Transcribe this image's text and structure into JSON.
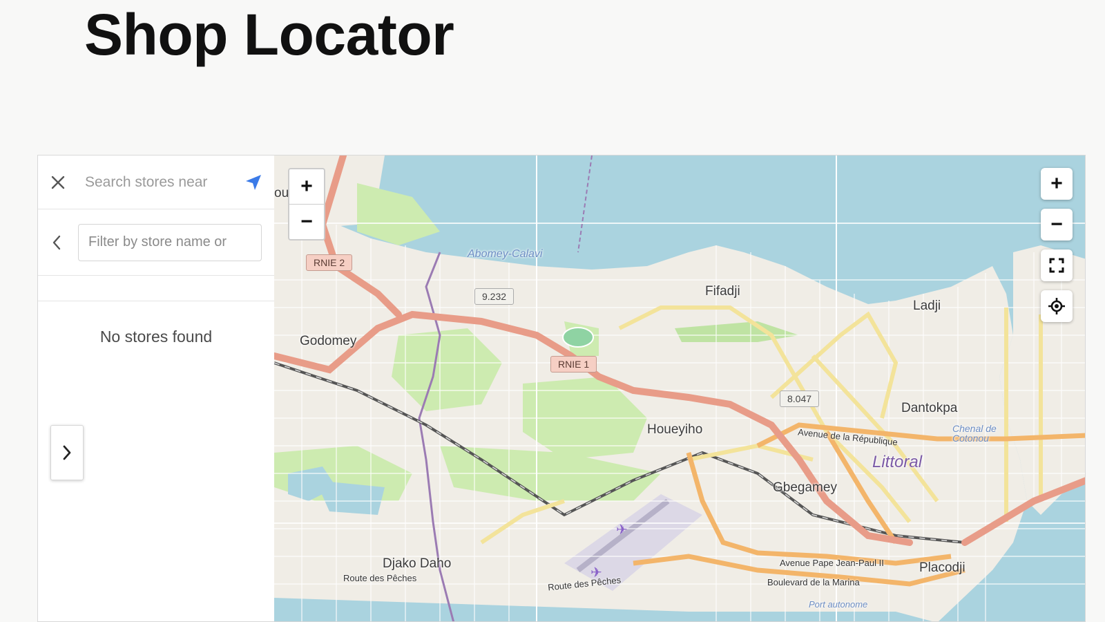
{
  "page": {
    "title": "Shop Locator"
  },
  "sidebar": {
    "search_placeholder": "Search stores near",
    "filter_placeholder": "Filter by store name or",
    "empty_message": "No stores found"
  },
  "map": {
    "zoom_in_label": "+",
    "zoom_out_label": "−",
    "labels": {
      "godomey": "Godomey",
      "fifadji": "Fifadji",
      "ladji": "Ladji",
      "dantokpa": "Dantokpa",
      "houeyiho": "Houeyiho",
      "gbegamey": "Gbegamey",
      "djako_daho": "Djako Daho",
      "placodji": "Placodji",
      "littoral": "Littoral",
      "abomey_calavi": "Abomey-Calavi",
      "chenal": "Chenal de Cotonou",
      "port": "Port autonome",
      "route_peches_1": "Route des Pêches",
      "route_peches_2": "Route des Pêches",
      "avenue_republique": "Avenue de la République",
      "avenue_jean_paul": "Avenue Pape Jean-Paul II",
      "boulevard_marina": "Boulevard de la Marina",
      "shield_rnie2": "RNIE 2",
      "shield_rnie1": "RNIE 1",
      "shield_9232": "9.232",
      "shield_8047": "8.047",
      "partial_left": "ou"
    }
  },
  "colors": {
    "water": "#aad3df",
    "land": "#f0ede6",
    "primary_road": "#e89c88",
    "secondary_road": "#f5e7a3",
    "orange_road": "#f3b56a",
    "park": "#cdebb0",
    "accent_blue": "#3b7be8"
  }
}
